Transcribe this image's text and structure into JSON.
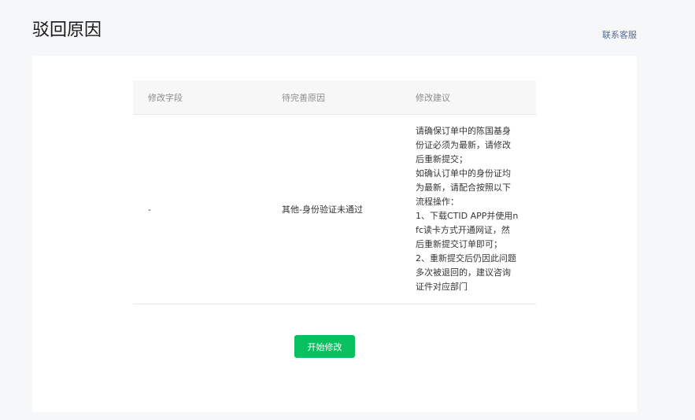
{
  "header": {
    "title": "驳回原因",
    "contact_label": "联系客服"
  },
  "table": {
    "columns": [
      "修改字段",
      "待完善原因",
      "修改建议"
    ],
    "rows": [
      {
        "field": "-",
        "reason": "其他-身份验证未通过",
        "suggestion_lines": [
          "请确保订单中的陈国基身",
          "份证必须为最新，请修改",
          "后重新提交；",
          "如确认订单中的身份证均",
          "为最新，请配合按照以下",
          "流程操作：",
          "1、下载CTID APP并使用n",
          "fc读卡方式开通网证，然",
          "后重新提交订单即可；",
          "2、重新提交后仍因此问题",
          "多次被退回的，建议咨询",
          "证件对应部门"
        ]
      }
    ]
  },
  "actions": {
    "start_edit_label": "开始修改"
  },
  "colors": {
    "primary": "#07c160",
    "link": "#576b95",
    "background": "#f6f7f9"
  }
}
